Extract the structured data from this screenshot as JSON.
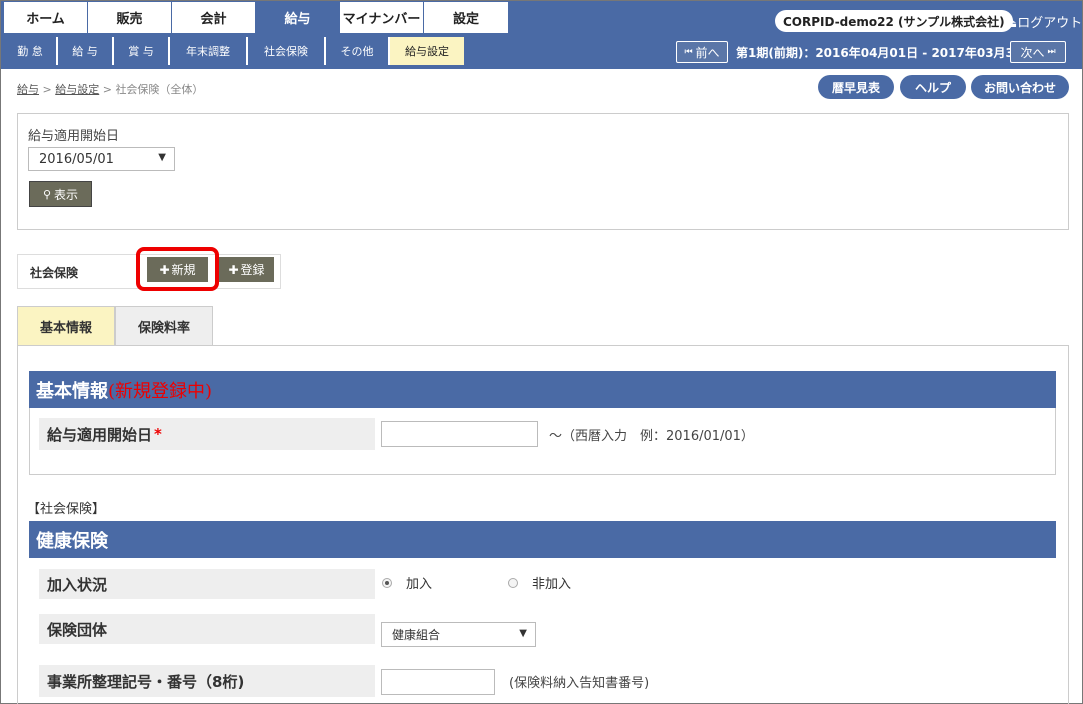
{
  "nav": {
    "tabs": [
      {
        "label": "ホーム"
      },
      {
        "label": "販売"
      },
      {
        "label": "会計"
      },
      {
        "label": "給与"
      },
      {
        "label": "マイナンバー"
      },
      {
        "label": "設定"
      }
    ],
    "company": "CORPID-demo22 (サンプル株式会社)",
    "logout": "ログアウト",
    "logout_icon": "eject-icon"
  },
  "subnav": {
    "tabs": [
      {
        "label": "勤 怠"
      },
      {
        "label": "給 与"
      },
      {
        "label": "賞 与"
      },
      {
        "label": "年末調整"
      },
      {
        "label": "社会保険"
      },
      {
        "label": "その他"
      },
      {
        "label": "給与設定"
      }
    ],
    "prev": "前へ",
    "next": "次へ",
    "period": "第1期(前期)：2016年04月01日 - 2017年03月31日"
  },
  "breadcrumb": {
    "item1": "給与",
    "sep1": " > ",
    "item2": "給与設定",
    "sep2": " > ",
    "current": "社会保険（全体）"
  },
  "header_buttons": {
    "calendar": "暦早見表",
    "help": "ヘルプ",
    "contact": "お問い合わせ"
  },
  "filter": {
    "label": "給与適用開始日",
    "selected": "2016/05/01",
    "show_button": "表示"
  },
  "actions": {
    "label": "社会保険",
    "new_button": "新規",
    "register_button": "登録"
  },
  "tabs": {
    "basic": "基本情報",
    "rates": "保険料率"
  },
  "basic_section": {
    "title": "基本情報",
    "status": "(新規登録中)",
    "start_date_label": "給与適用開始日",
    "required_mark": "*",
    "start_date_value": "",
    "start_date_hint": "～（西暦入力　例：2016/01/01）"
  },
  "social_insurance": {
    "group_label": "【社会保険】",
    "health_title": "健康保険",
    "enrollment_label": "加入状況",
    "enrolled": "加入",
    "not_enrolled": "非加入",
    "organization_label": "保険団体",
    "organization_value": "健康組合",
    "office_code_label": "事業所整理記号・番号（8桁)",
    "office_code_value": "",
    "office_code_hint": "(保険料納入告知書番号)"
  },
  "colors": {
    "nav_blue": "#4a6aa5",
    "active_tab": "#fbf4c2",
    "button_olive": "#6b6b5a",
    "highlight_red": "#ee0000"
  }
}
